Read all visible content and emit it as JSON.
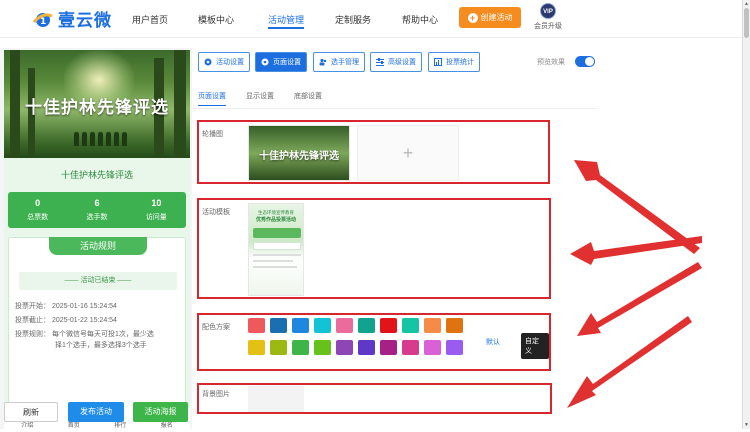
{
  "brand": {
    "name": "壹云微"
  },
  "nav": {
    "items": [
      "用户首页",
      "模板中心",
      "活动管理",
      "定制服务",
      "帮助中心"
    ],
    "active_index": 2,
    "create_button": "创建活动",
    "vip_badge": "VIP",
    "vip_label": "会员升级"
  },
  "preview": {
    "banner_title": "十佳护林先锋评选",
    "app_title": "十佳护林先锋评选",
    "stats": [
      {
        "value": "0",
        "label": "总票数"
      },
      {
        "value": "6",
        "label": "选手数"
      },
      {
        "value": "10",
        "label": "访问量"
      }
    ],
    "rules_title": "活动规则",
    "ended_text": "—— 活动已结束 ——",
    "vote_start": "投票开始：  2025-01-16 15:24:54",
    "vote_end": "投票截止：  2025-01-22 15:24:54",
    "vote_rule_1": "投票规则：  每个微信号每天可投1次，最少选",
    "vote_rule_2": "择1个选手，最多选择3个选手",
    "tabbar": [
      "介绍",
      "首页",
      "排行",
      "报名"
    ],
    "tabbar_active_index": 1
  },
  "bottom_buttons": {
    "reset": "刷新",
    "publish": "发布活动",
    "poster": "活动海报"
  },
  "toolbar": {
    "buttons": [
      "活动设置",
      "页面设置",
      "选手管理",
      "高级设置",
      "投票统计"
    ],
    "active_index": 1,
    "preview_toggle_label": "预览效果",
    "preview_toggle_on": true
  },
  "subtabs": {
    "items": [
      "页面设置",
      "显示设置",
      "底部设置"
    ],
    "active_index": 0
  },
  "sections": {
    "carousel_label": "轮播图",
    "carousel_thumb_title": "十佳护林先锋评选",
    "template_label": "活动模板",
    "template_thumb_line1": "生态环境宣传教育",
    "template_thumb_line2": "优秀作品投票活动",
    "color_label": "配色方案",
    "default_link": "默认",
    "custom_button": "自定义",
    "bg_label": "背景图片"
  },
  "palette": {
    "row1": [
      "#f0595b",
      "#1b6eaf",
      "#1e87e0",
      "#14c2d6",
      "#ea6b9c",
      "#11a38e",
      "#e3131a",
      "#14c5a4",
      "#f68b47",
      "#de7310"
    ],
    "row2": [
      "#e3c013",
      "#9cb813",
      "#3eb548",
      "#66c21a",
      "#8e45b5",
      "#5f38c8",
      "#a62086",
      "#d63b8e",
      "#d960d6",
      "#9a5bf0"
    ]
  },
  "colors": {
    "accent": "#1d6fe0",
    "highlight_border": "#d8262e",
    "create_orange": "#f68c1f",
    "green": "#4cb85c"
  }
}
